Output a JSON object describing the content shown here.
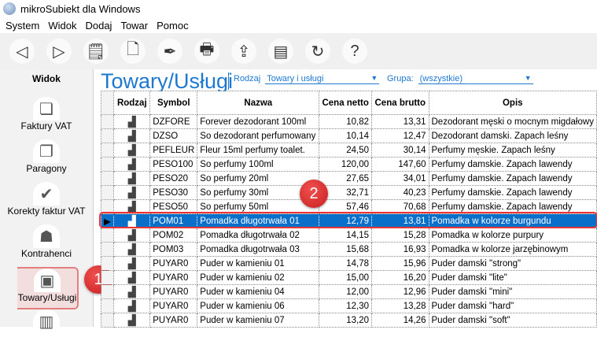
{
  "window": {
    "title": "mikroSubiekt dla Windows"
  },
  "menu": [
    "System",
    "Widok",
    "Dodaj",
    "Towar",
    "Pomoc"
  ],
  "toolbar": [
    {
      "icon": "back-arrow-icon",
      "glyph": "◁"
    },
    {
      "icon": "forward-arrow-icon",
      "glyph": "▷"
    },
    {
      "icon": "document-clock-icon",
      "glyph": "🗒"
    },
    {
      "icon": "new-document-icon",
      "glyph": "🗋"
    },
    {
      "icon": "pen-icon",
      "glyph": "✒"
    },
    {
      "icon": "printer-icon",
      "glyph": "🖶"
    },
    {
      "icon": "export-icon",
      "glyph": "⇪"
    },
    {
      "icon": "fiscal-printer-icon",
      "glyph": "▤"
    },
    {
      "icon": "refresh-icon",
      "glyph": "↻"
    },
    {
      "icon": "help-icon",
      "glyph": "?"
    }
  ],
  "sidebar": {
    "title": "Widok",
    "items": [
      {
        "label": "Faktury VAT",
        "glyph": "❏"
      },
      {
        "label": "Paragony",
        "glyph": "❐"
      },
      {
        "label": "Korekty faktur VAT",
        "glyph": "✔"
      },
      {
        "label": "Kontrahenci",
        "glyph": "☗"
      },
      {
        "label": "Towary/Usługi",
        "glyph": "▣",
        "active": true
      }
    ]
  },
  "main": {
    "title": "Towary/Usługi",
    "rodzaj_label": "Rodzaj",
    "rodzaj_value": "Towary i usługi",
    "grupa_label": "Grupa:",
    "grupa_value": "(wszystkie)"
  },
  "table": {
    "headers": [
      "Rodzaj",
      "Symbol",
      "Nazwa",
      "Cena netto",
      "Cena brutto",
      "Opis"
    ],
    "rows": [
      [
        "DZFORE",
        "Forever dezodorant 100ml",
        "10,82",
        "13,31",
        "Dezodorant męski o mocnym migdałowy"
      ],
      [
        "DZSO",
        "So dezodorant perfumowany",
        "10,14",
        "12,47",
        "Dezodorant damski. Zapach leśny"
      ],
      [
        "PEFLEUR",
        "Fleur 15ml perfumy toalet.",
        "24,50",
        "30,14",
        "Perfumy męskie. Zapach leśny"
      ],
      [
        "PESO100",
        "So perfumy 100ml",
        "120,00",
        "147,60",
        "Perfumy damskie. Zapach lawendy"
      ],
      [
        "PESO20",
        "So perfumy 20ml",
        "27,65",
        "34,01",
        "Perfumy damskie. Zapach lawendy"
      ],
      [
        "PESO30",
        "So perfumy 30ml",
        "32,71",
        "40,23",
        "Perfumy damskie. Zapach lawendy"
      ],
      [
        "PESO50",
        "So perfumy 50ml",
        "57,46",
        "70,68",
        "Perfumy damskie. Zapach lawendy"
      ],
      [
        "POM01",
        "Pomadka długotrwała 01",
        "12,79",
        "13,81",
        "Pomadka w kolorze burgundu"
      ],
      [
        "POM02",
        "Pomadka długotrwała 02",
        "14,15",
        "15,28",
        "Pomadka w kolorze purpury"
      ],
      [
        "POM03",
        "Pomadka długotrwała 03",
        "15,68",
        "16,93",
        "Pomadka w kolorze jarzębinowym"
      ],
      [
        "PUYAR0",
        "Puder w kamieniu 01",
        "14,78",
        "15,96",
        "Puder damski \"strong\""
      ],
      [
        "PUYAR0",
        "Puder w kamieniu 02",
        "15,00",
        "16,20",
        "Puder damski \"lite\""
      ],
      [
        "PUYAR0",
        "Puder w kamieniu 04",
        "12,00",
        "12,96",
        "Puder damski \"mini\""
      ],
      [
        "PUYAR0",
        "Puder w kamieniu 06",
        "12,30",
        "13,28",
        "Puder damski \"hard\""
      ],
      [
        "PUYAR0",
        "Puder w kamieniu 07",
        "13,20",
        "14,26",
        "Puder damski \"soft\""
      ]
    ],
    "selected_index": 7
  },
  "badges": {
    "one": "1",
    "two": "2"
  },
  "colors": {
    "accent": "#1d78d0",
    "selection": "#0a6fc9",
    "badge": "#d42a2a"
  }
}
